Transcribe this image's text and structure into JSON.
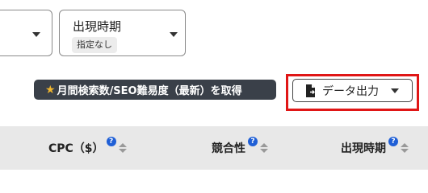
{
  "filters": {
    "left_select": {},
    "appearance_period": {
      "label": "出現時期",
      "value": "指定なし"
    }
  },
  "actions": {
    "fetch_button_label": "月間検索数/SEO難易度（最新）を取得",
    "export_button_label": "データ出力"
  },
  "table": {
    "columns": [
      {
        "label": "CPC（$）",
        "help": "?"
      },
      {
        "label": "競合性",
        "help": "?"
      },
      {
        "label": "出現時期",
        "help": "?"
      }
    ]
  },
  "colors": {
    "dark_button": "#3a4049",
    "highlight": "#e01616",
    "help_icon": "#1f5fd6",
    "star": "#f2b72e",
    "header_bg": "#e8e8e8"
  }
}
